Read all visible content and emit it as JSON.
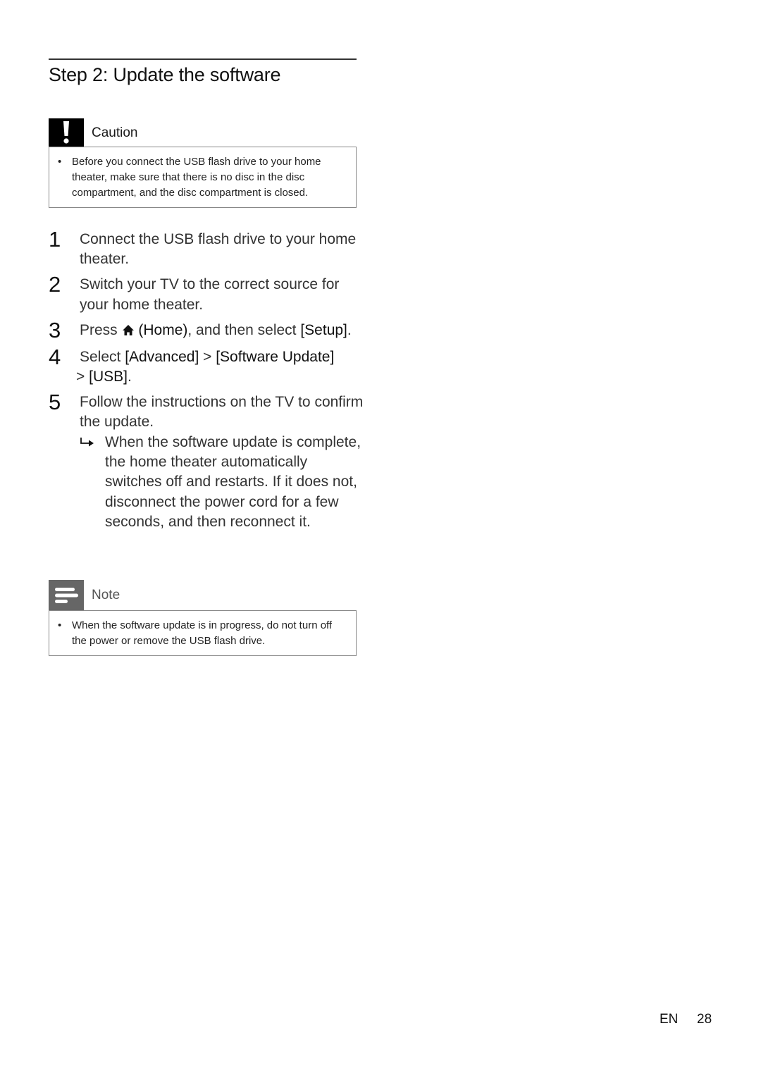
{
  "page": {
    "title": "Step 2: Update the software",
    "footer": {
      "language": "EN",
      "page_number": "28"
    }
  },
  "caution": {
    "icon": "exclamation-icon",
    "label": "Caution",
    "bullets": [
      "Before you connect the USB flash drive to your home theater, make sure that there is no disc in the disc compartment, and the disc compartment is closed."
    ]
  },
  "steps": [
    {
      "number": "1",
      "text": "Connect the USB flash drive to your home theater."
    },
    {
      "number": "2",
      "text": "Switch your TV to the correct source for your home theater."
    },
    {
      "number": "3",
      "prefix": "Press",
      "icon": "home-icon",
      "home_label": "(Home)",
      "middle": ", and then select ",
      "menu_item": "[Setup]",
      "suffix": "."
    },
    {
      "number": "4",
      "prefix": "Select ",
      "path": [
        "[Advanced]",
        "[Software Update]",
        "[USB]"
      ],
      "separator": " > ",
      "suffix": "."
    },
    {
      "number": "5",
      "text": "Follow the instructions on the TV to confirm the update.",
      "result": {
        "icon": "result-arrow-icon",
        "text": "When the software update is complete, the home theater automatically switches off and restarts. If it does not, disconnect the power cord for a few seconds, and then reconnect it."
      }
    }
  ],
  "note": {
    "icon": "note-lines-icon",
    "label": "Note",
    "bullets": [
      "When the software update is in progress, do not turn off the power or remove the USB flash drive."
    ]
  }
}
